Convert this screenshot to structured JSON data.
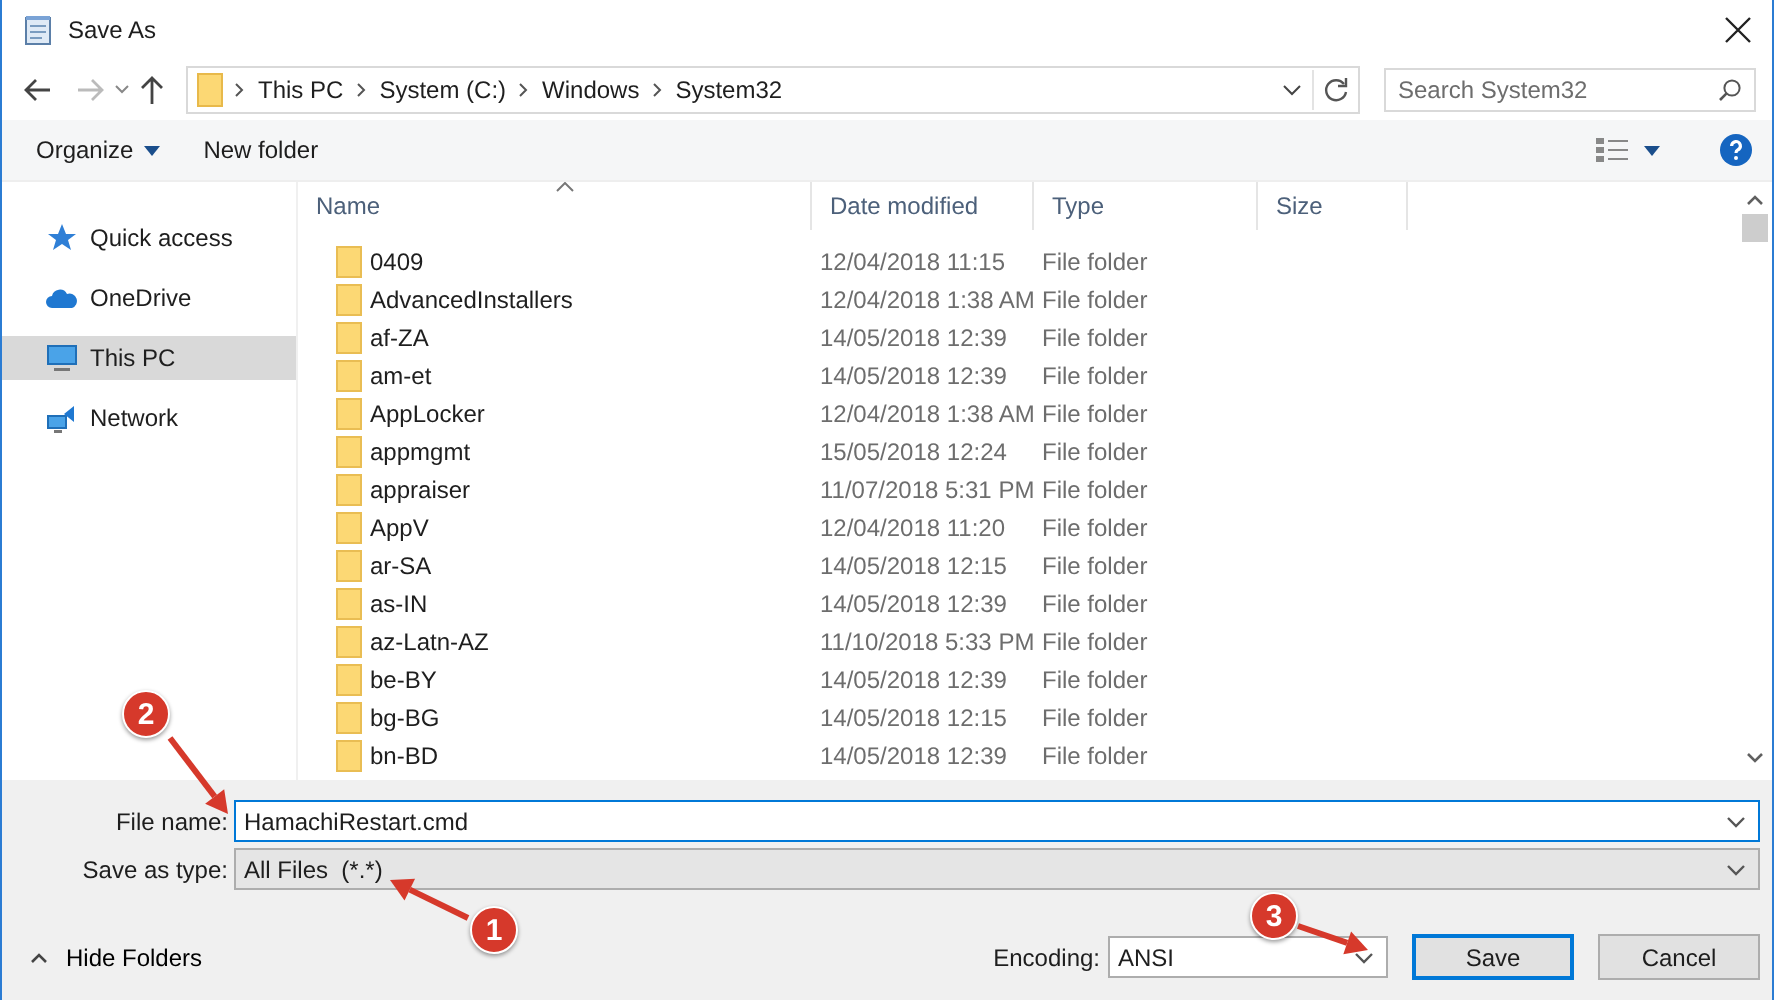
{
  "window": {
    "title": "Save As"
  },
  "nav": {
    "back_disabled": false,
    "forward_disabled": true
  },
  "address": {
    "path": [
      "This PC",
      "System (C:)",
      "Windows",
      "System32"
    ]
  },
  "search": {
    "placeholder": "Search System32"
  },
  "toolbar": {
    "organize": "Organize",
    "new_folder": "New folder"
  },
  "sidebar": {
    "items": [
      {
        "label": "Quick access",
        "kind": "star",
        "selected": false
      },
      {
        "label": "OneDrive",
        "kind": "cloud",
        "selected": false
      },
      {
        "label": "This PC",
        "kind": "computer",
        "selected": true
      },
      {
        "label": "Network",
        "kind": "network",
        "selected": false
      }
    ]
  },
  "table": {
    "columns": [
      "Name",
      "Date modified",
      "Type",
      "Size"
    ],
    "rows": [
      {
        "name": "0409",
        "date": "12/04/2018 11:15",
        "type": "File folder"
      },
      {
        "name": "AdvancedInstallers",
        "date": "12/04/2018 1:38 AM",
        "type": "File folder"
      },
      {
        "name": "af-ZA",
        "date": "14/05/2018 12:39",
        "type": "File folder"
      },
      {
        "name": "am-et",
        "date": "14/05/2018 12:39",
        "type": "File folder"
      },
      {
        "name": "AppLocker",
        "date": "12/04/2018 1:38 AM",
        "type": "File folder"
      },
      {
        "name": "appmgmt",
        "date": "15/05/2018 12:24",
        "type": "File folder"
      },
      {
        "name": "appraiser",
        "date": "11/07/2018 5:31 PM",
        "type": "File folder"
      },
      {
        "name": "AppV",
        "date": "12/04/2018 11:20",
        "type": "File folder"
      },
      {
        "name": "ar-SA",
        "date": "14/05/2018 12:15",
        "type": "File folder"
      },
      {
        "name": "as-IN",
        "date": "14/05/2018 12:39",
        "type": "File folder"
      },
      {
        "name": "az-Latn-AZ",
        "date": "11/10/2018 5:33 PM",
        "type": "File folder"
      },
      {
        "name": "be-BY",
        "date": "14/05/2018 12:39",
        "type": "File folder"
      },
      {
        "name": "bg-BG",
        "date": "14/05/2018 12:15",
        "type": "File folder"
      },
      {
        "name": "bn-BD",
        "date": "14/05/2018 12:39",
        "type": "File folder"
      }
    ]
  },
  "form": {
    "file_name_label": "File name:",
    "file_name": "HamachiRestart.cmd",
    "type_label": "Save as type:",
    "type": "All Files  (*.*)",
    "encoding_label": "Encoding:",
    "encoding": "ANSI"
  },
  "hide_folders": "Hide Folders",
  "buttons": [
    {
      "label": "Save",
      "default": true
    },
    {
      "label": "Cancel",
      "default": false
    }
  ],
  "callouts": [
    {
      "number": "2"
    },
    {
      "number": "1"
    },
    {
      "number": "3"
    }
  ]
}
